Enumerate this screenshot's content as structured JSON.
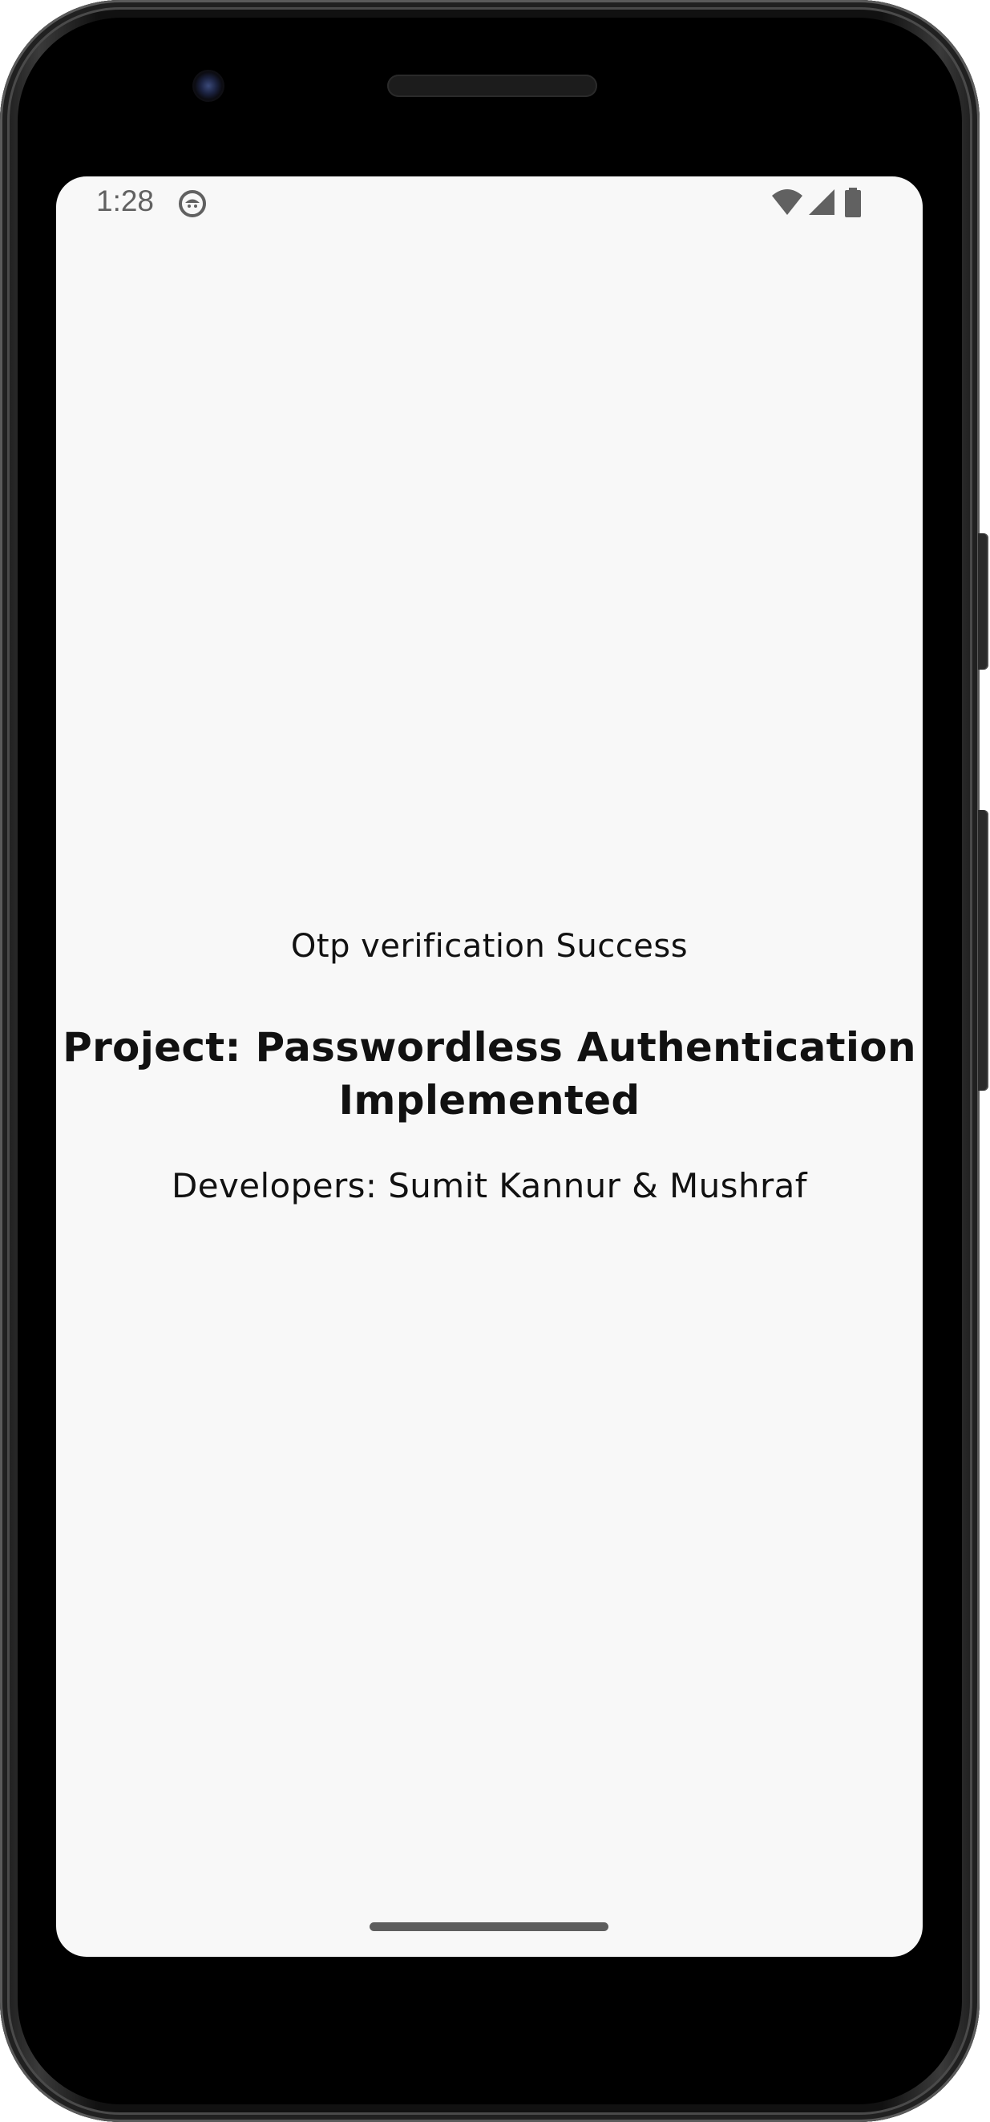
{
  "status_bar": {
    "time": "1:28",
    "notification_icon": "android-debug-icon",
    "icons": [
      "wifi-icon",
      "signal-icon",
      "battery-icon"
    ]
  },
  "main": {
    "status_message": "Otp verification Success",
    "project_line1": "Project: Passwordless Authentication",
    "project_line2": "Implemented",
    "developers": "Developers: Sumit Kannur & Mushraf"
  },
  "colors": {
    "screen_background": "#f8f8f8",
    "text": "#111111",
    "status_text": "#616161",
    "frame": "#111111"
  }
}
